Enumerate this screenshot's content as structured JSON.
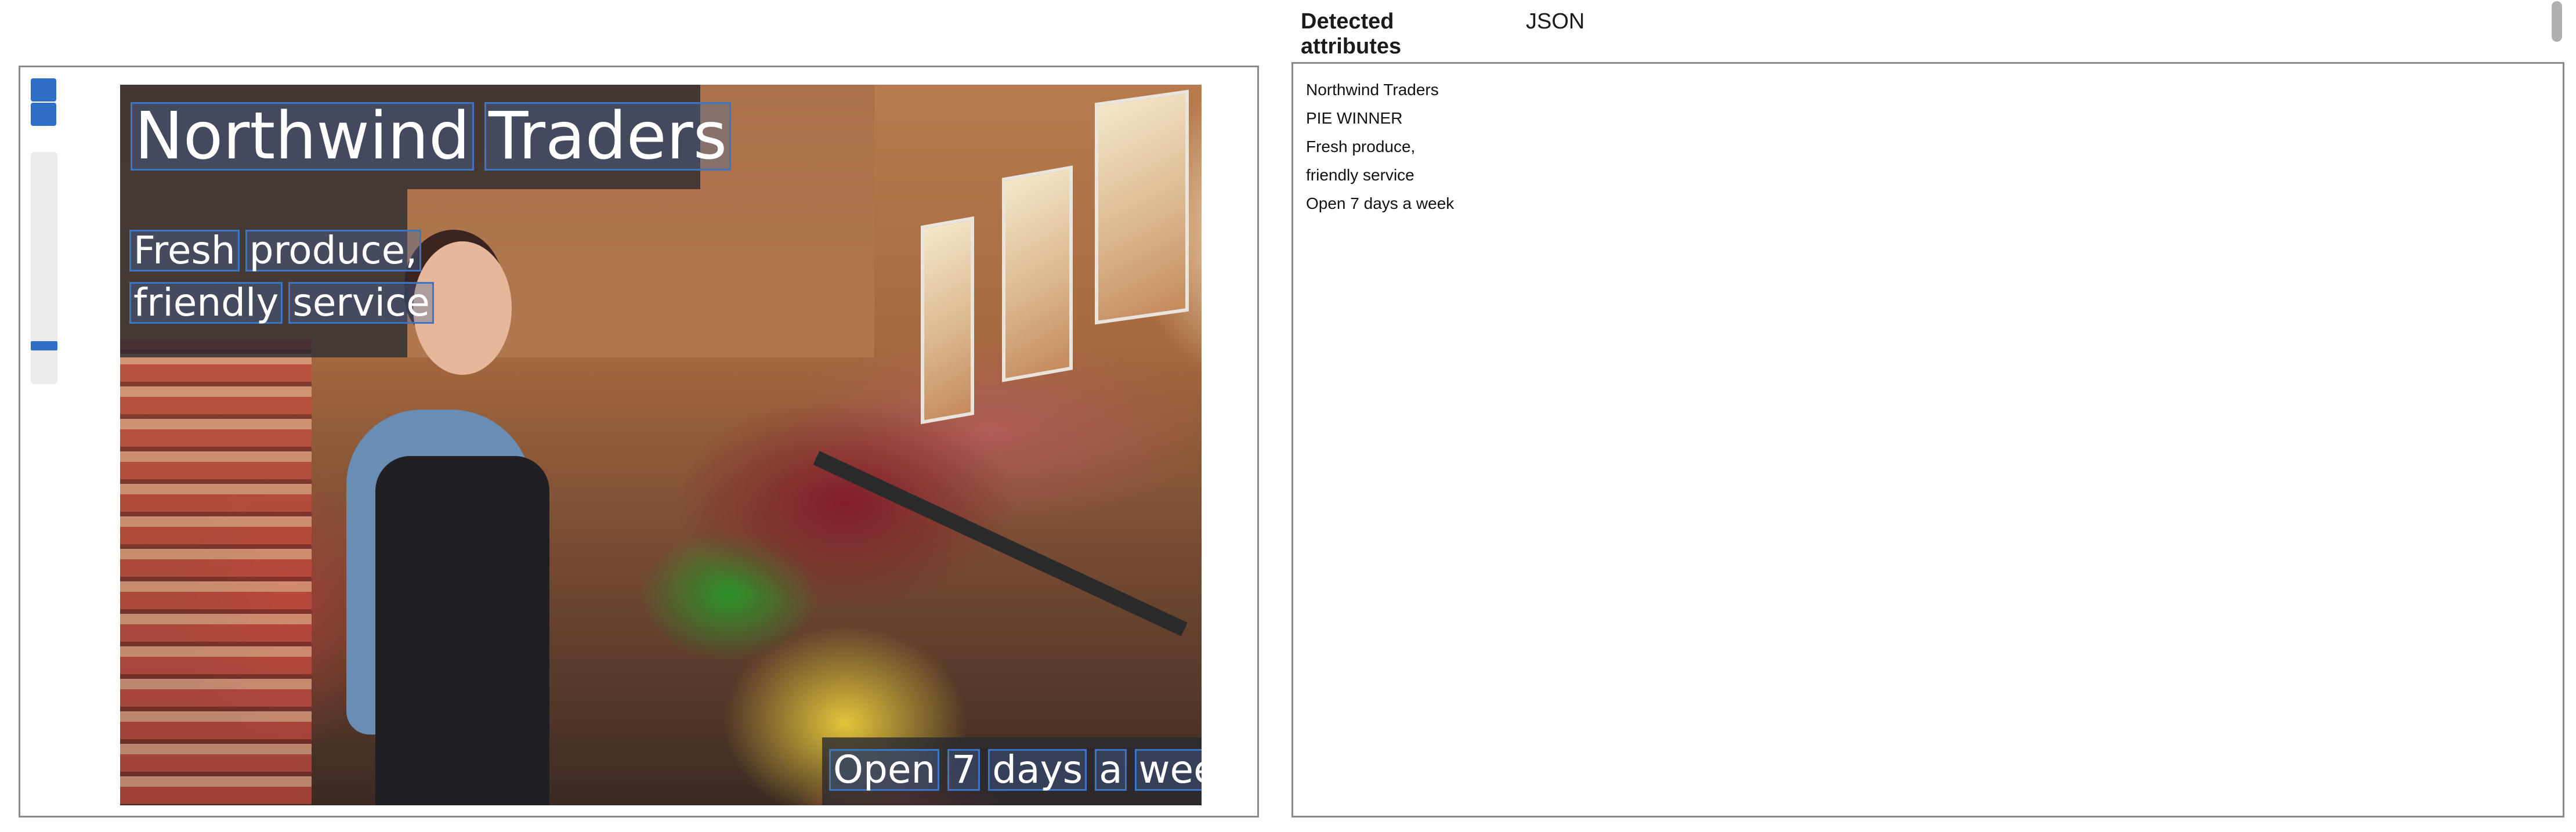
{
  "viewer": {
    "overlay": {
      "title_words": [
        "Northwind",
        "Traders"
      ],
      "sub1_words": [
        "Fresh",
        "produce,"
      ],
      "sub2_words": [
        "friendly",
        "service"
      ],
      "foot_words": [
        "Open",
        "7",
        "days",
        "a",
        "week"
      ]
    },
    "zoom_level": 0.08
  },
  "tabs": [
    {
      "label": "Detected attributes",
      "active": true
    },
    {
      "label": "JSON",
      "active": false
    }
  ],
  "attributes": [
    "Northwind Traders",
    "PIE WINNER",
    "Fresh produce,",
    "friendly service",
    "Open 7 days a week"
  ],
  "colors": {
    "accent": "#2f6fc8",
    "border": "#8a8a8a"
  }
}
